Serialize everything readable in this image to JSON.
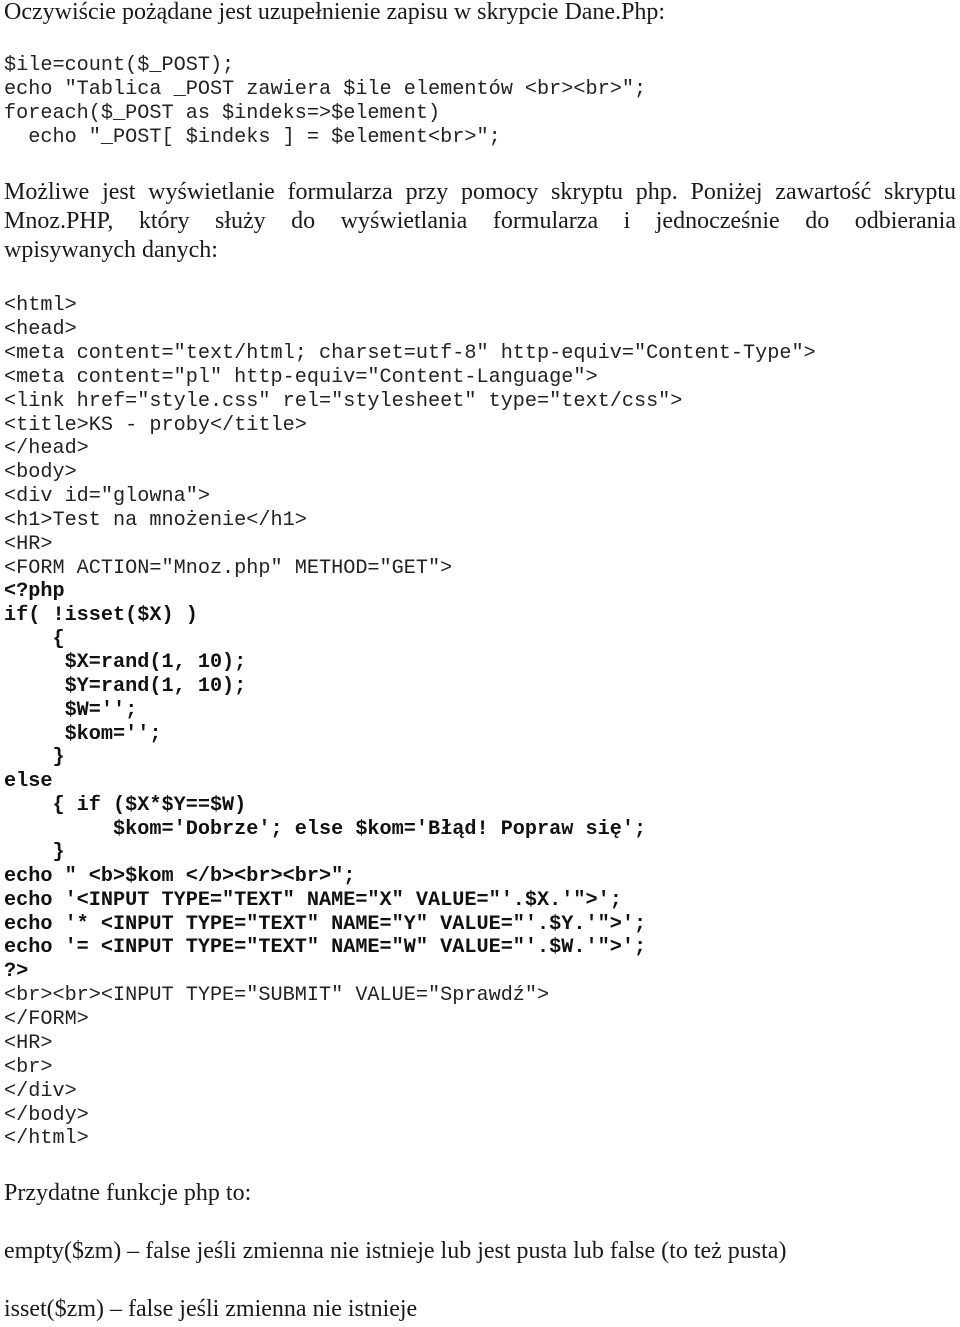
{
  "intro": {
    "text": "Oczywiście pożądane jest uzupełnienie zapisu w skrypcie Dane.Php:"
  },
  "code_block_1": {
    "lines": [
      "$ile=count($_POST);",
      "echo \"Tablica _POST zawiera $ile elementów <br><br>\";",
      "foreach($_POST as $indeks=>$element)",
      "  echo \"_POST[ $indeks ] = $element<br>\";"
    ]
  },
  "paragraph_2": {
    "lines": [
      "Możliwe jest wyświetlanie formularza przy pomocy skryptu php. Poniżej zawartość skryptu",
      "Mnoz.PHP, który służy do wyświetlania formularza i jednocześnie do odbierania",
      "wpisywanych danych:"
    ]
  },
  "code_block_2": {
    "html_head_lines": [
      "<html>",
      "<head>",
      "<meta content=\"text/html; charset=utf-8\" http-equiv=\"Content-Type\">",
      "<meta content=\"pl\" http-equiv=\"Content-Language\">",
      "<link href=\"style.css\" rel=\"stylesheet\" type=\"text/css\">",
      "<title>KS - proby</title>",
      "</head>",
      "<body>",
      "<div id=\"glowna\">",
      "<h1>Test na mnożenie</h1>",
      "<HR>",
      "<FORM ACTION=\"Mnoz.php\" METHOD=\"GET\">"
    ],
    "php_lines": [
      "<?php",
      "if( !isset($X) )",
      "    {",
      "     $X=rand(1, 10);",
      "     $Y=rand(1, 10);",
      "     $W='';",
      "     $kom='';",
      "    }",
      "else",
      "    { if ($X*$Y==$W)",
      "         $kom='Dobrze'; else $kom='Błąd! Popraw się';",
      "    }",
      "echo \" <b>$kom </b><br><br>\";",
      "echo '<INPUT TYPE=\"TEXT\" NAME=\"X\" VALUE=\"'.$X.'\">';",
      "echo '* <INPUT TYPE=\"TEXT\" NAME=\"Y\" VALUE=\"'.$Y.'\">';",
      "echo '= <INPUT TYPE=\"TEXT\" NAME=\"W\" VALUE=\"'.$W.'\">';",
      "?>"
    ],
    "html_tail_lines": [
      "<br><br><INPUT TYPE=\"SUBMIT\" VALUE=\"Sprawdź\">",
      "</FORM>",
      "<HR>",
      "<br>",
      "</div>",
      "</body>",
      "</html>"
    ]
  },
  "useful_functions": {
    "heading": "Przydatne funkcje php to:",
    "items": [
      "empty($zm) – false jeśli zmienna nie istnieje lub jest pusta lub false (to też pusta)",
      "isset($zm) – false jeśli zmienna nie istnieje"
    ]
  }
}
